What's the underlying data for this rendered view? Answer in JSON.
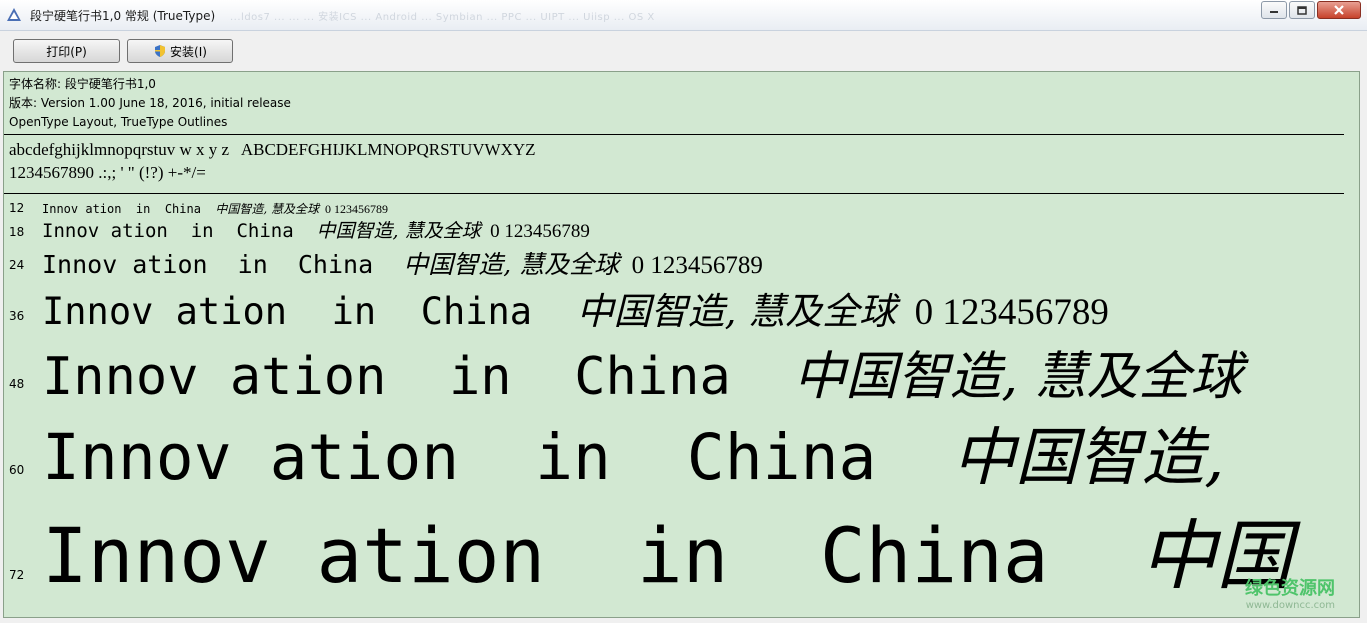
{
  "window": {
    "title": "段宁硬笔行书1,0 常规 (TrueType)",
    "ghost_text": "...ldos7 ...  ...  ...  安装ICS ... Android ... Symbian ... PPC ... UIPT ... Uiisp ... OS X"
  },
  "toolbar": {
    "print_label": "打印(P)",
    "install_label": "安装(I)"
  },
  "info": {
    "font_name": "字体名称: 段宁硬笔行书1,0",
    "version": "版本: Version 1.00 June 18, 2016, initial release",
    "outlines": "OpenType Layout, TrueType Outlines"
  },
  "charset": {
    "line1": "abcdefghijklmnopqrstuv w x y z   ABCDEFGHIJKLMNOPQRSTUVWXYZ",
    "line2": "1234567890 .:,; ' \" (!?) +-*/="
  },
  "samples": [
    {
      "size": "12",
      "latin": "Innov ation  in  China  ",
      "cn": "中国智造, 慧及全球",
      "num": "  0 123456789"
    },
    {
      "size": "18",
      "latin": "Innov ation  in  China  ",
      "cn": "中国智造, 慧及全球",
      "num": "  0 123456789"
    },
    {
      "size": "24",
      "latin": "Innov ation  in  China  ",
      "cn": "中国智造, 慧及全球",
      "num": "  0 123456789"
    },
    {
      "size": "36",
      "latin": "Innov ation  in  China  ",
      "cn": "中国智造, 慧及全球",
      "num": "  0 123456789"
    },
    {
      "size": "48",
      "latin": "Innov ation  in  China  ",
      "cn": "中国智造, 慧及全球",
      "num": ""
    },
    {
      "size": "60",
      "latin": "Innov ation  in  China  ",
      "cn": "中国智造,",
      "num": ""
    },
    {
      "size": "72",
      "latin": "Innov ation  in  China  ",
      "cn": "中国",
      "num": ""
    }
  ],
  "watermark": {
    "main": "绿色资源网",
    "sub": "www.downcc.com"
  },
  "colors": {
    "panel_bg": "#d2e8d2",
    "watermark": "#4fc46b"
  }
}
